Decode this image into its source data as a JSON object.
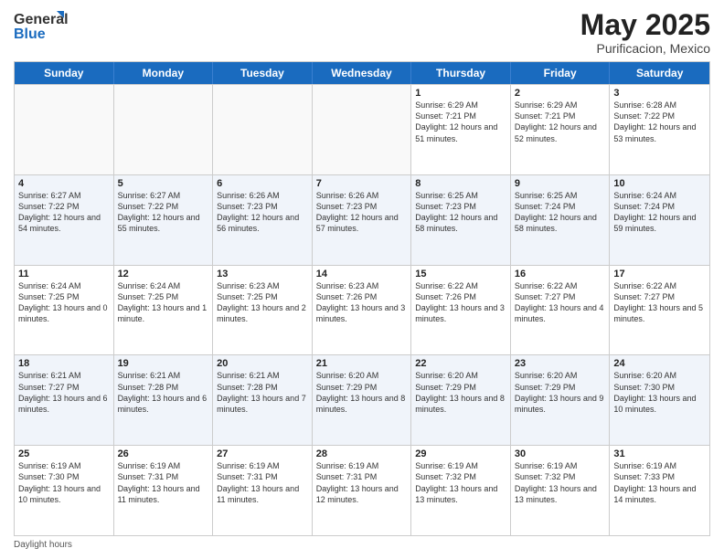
{
  "header": {
    "logo_general": "General",
    "logo_blue": "Blue",
    "month_title": "May 2025",
    "location": "Purificacion, Mexico"
  },
  "days_of_week": [
    "Sunday",
    "Monday",
    "Tuesday",
    "Wednesday",
    "Thursday",
    "Friday",
    "Saturday"
  ],
  "weeks": [
    [
      {
        "day": "",
        "info": ""
      },
      {
        "day": "",
        "info": ""
      },
      {
        "day": "",
        "info": ""
      },
      {
        "day": "",
        "info": ""
      },
      {
        "day": "1",
        "info": "Sunrise: 6:29 AM\nSunset: 7:21 PM\nDaylight: 12 hours and 51 minutes."
      },
      {
        "day": "2",
        "info": "Sunrise: 6:29 AM\nSunset: 7:21 PM\nDaylight: 12 hours and 52 minutes."
      },
      {
        "day": "3",
        "info": "Sunrise: 6:28 AM\nSunset: 7:22 PM\nDaylight: 12 hours and 53 minutes."
      }
    ],
    [
      {
        "day": "4",
        "info": "Sunrise: 6:27 AM\nSunset: 7:22 PM\nDaylight: 12 hours and 54 minutes."
      },
      {
        "day": "5",
        "info": "Sunrise: 6:27 AM\nSunset: 7:22 PM\nDaylight: 12 hours and 55 minutes."
      },
      {
        "day": "6",
        "info": "Sunrise: 6:26 AM\nSunset: 7:23 PM\nDaylight: 12 hours and 56 minutes."
      },
      {
        "day": "7",
        "info": "Sunrise: 6:26 AM\nSunset: 7:23 PM\nDaylight: 12 hours and 57 minutes."
      },
      {
        "day": "8",
        "info": "Sunrise: 6:25 AM\nSunset: 7:23 PM\nDaylight: 12 hours and 58 minutes."
      },
      {
        "day": "9",
        "info": "Sunrise: 6:25 AM\nSunset: 7:24 PM\nDaylight: 12 hours and 58 minutes."
      },
      {
        "day": "10",
        "info": "Sunrise: 6:24 AM\nSunset: 7:24 PM\nDaylight: 12 hours and 59 minutes."
      }
    ],
    [
      {
        "day": "11",
        "info": "Sunrise: 6:24 AM\nSunset: 7:25 PM\nDaylight: 13 hours and 0 minutes."
      },
      {
        "day": "12",
        "info": "Sunrise: 6:24 AM\nSunset: 7:25 PM\nDaylight: 13 hours and 1 minute."
      },
      {
        "day": "13",
        "info": "Sunrise: 6:23 AM\nSunset: 7:25 PM\nDaylight: 13 hours and 2 minutes."
      },
      {
        "day": "14",
        "info": "Sunrise: 6:23 AM\nSunset: 7:26 PM\nDaylight: 13 hours and 3 minutes."
      },
      {
        "day": "15",
        "info": "Sunrise: 6:22 AM\nSunset: 7:26 PM\nDaylight: 13 hours and 3 minutes."
      },
      {
        "day": "16",
        "info": "Sunrise: 6:22 AM\nSunset: 7:27 PM\nDaylight: 13 hours and 4 minutes."
      },
      {
        "day": "17",
        "info": "Sunrise: 6:22 AM\nSunset: 7:27 PM\nDaylight: 13 hours and 5 minutes."
      }
    ],
    [
      {
        "day": "18",
        "info": "Sunrise: 6:21 AM\nSunset: 7:27 PM\nDaylight: 13 hours and 6 minutes."
      },
      {
        "day": "19",
        "info": "Sunrise: 6:21 AM\nSunset: 7:28 PM\nDaylight: 13 hours and 6 minutes."
      },
      {
        "day": "20",
        "info": "Sunrise: 6:21 AM\nSunset: 7:28 PM\nDaylight: 13 hours and 7 minutes."
      },
      {
        "day": "21",
        "info": "Sunrise: 6:20 AM\nSunset: 7:29 PM\nDaylight: 13 hours and 8 minutes."
      },
      {
        "day": "22",
        "info": "Sunrise: 6:20 AM\nSunset: 7:29 PM\nDaylight: 13 hours and 8 minutes."
      },
      {
        "day": "23",
        "info": "Sunrise: 6:20 AM\nSunset: 7:29 PM\nDaylight: 13 hours and 9 minutes."
      },
      {
        "day": "24",
        "info": "Sunrise: 6:20 AM\nSunset: 7:30 PM\nDaylight: 13 hours and 10 minutes."
      }
    ],
    [
      {
        "day": "25",
        "info": "Sunrise: 6:19 AM\nSunset: 7:30 PM\nDaylight: 13 hours and 10 minutes."
      },
      {
        "day": "26",
        "info": "Sunrise: 6:19 AM\nSunset: 7:31 PM\nDaylight: 13 hours and 11 minutes."
      },
      {
        "day": "27",
        "info": "Sunrise: 6:19 AM\nSunset: 7:31 PM\nDaylight: 13 hours and 11 minutes."
      },
      {
        "day": "28",
        "info": "Sunrise: 6:19 AM\nSunset: 7:31 PM\nDaylight: 13 hours and 12 minutes."
      },
      {
        "day": "29",
        "info": "Sunrise: 6:19 AM\nSunset: 7:32 PM\nDaylight: 13 hours and 13 minutes."
      },
      {
        "day": "30",
        "info": "Sunrise: 6:19 AM\nSunset: 7:32 PM\nDaylight: 13 hours and 13 minutes."
      },
      {
        "day": "31",
        "info": "Sunrise: 6:19 AM\nSunset: 7:33 PM\nDaylight: 13 hours and 14 minutes."
      }
    ]
  ],
  "footer": {
    "note": "Daylight hours"
  }
}
